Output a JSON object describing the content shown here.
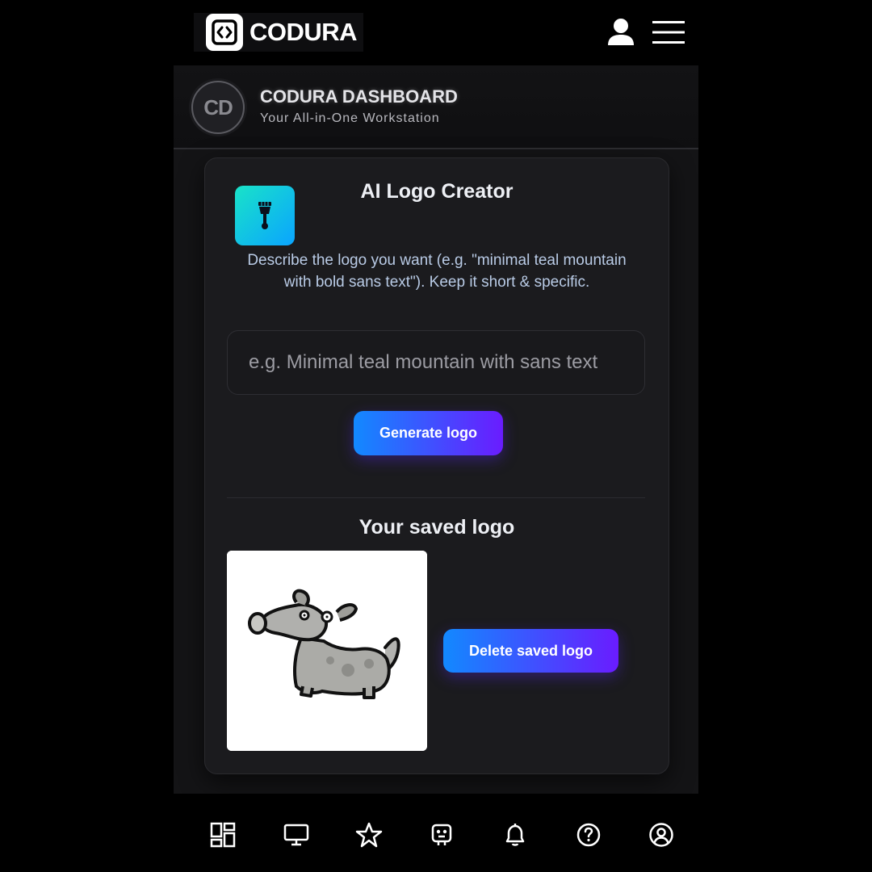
{
  "topbar": {
    "brand_name": "CODURA",
    "icons": [
      "code-brackets-icon",
      "user-icon",
      "hamburger-menu-icon"
    ]
  },
  "dashboard": {
    "avatar_initials": "CD",
    "title": "CODURA DASHBOARD",
    "subtitle": "Your All-in-One Workstation"
  },
  "logo_creator": {
    "icon": "paintbrush-icon",
    "title": "AI Logo Creator",
    "description": "Describe the logo you want (e.g. \"minimal teal mountain with bold sans text\"). Keep it short & specific.",
    "input_placeholder": "e.g. Minimal teal mountain with sans text",
    "input_value": "",
    "generate_label": "Generate logo"
  },
  "saved": {
    "title": "Your saved logo",
    "image": "dog-cartoon-logo",
    "delete_label": "Delete saved logo"
  },
  "bottom_nav": {
    "items": [
      "dashboard-icon",
      "monitor-icon",
      "star-icon",
      "robot-icon",
      "bell-icon",
      "help-icon",
      "profile-icon"
    ]
  },
  "colors": {
    "accent_start": "#1289ff",
    "accent_end": "#6a1cff",
    "tool_icon_start": "#19e3c8",
    "tool_icon_end": "#0aa4ff",
    "card_bg": "#1b1b1e"
  }
}
